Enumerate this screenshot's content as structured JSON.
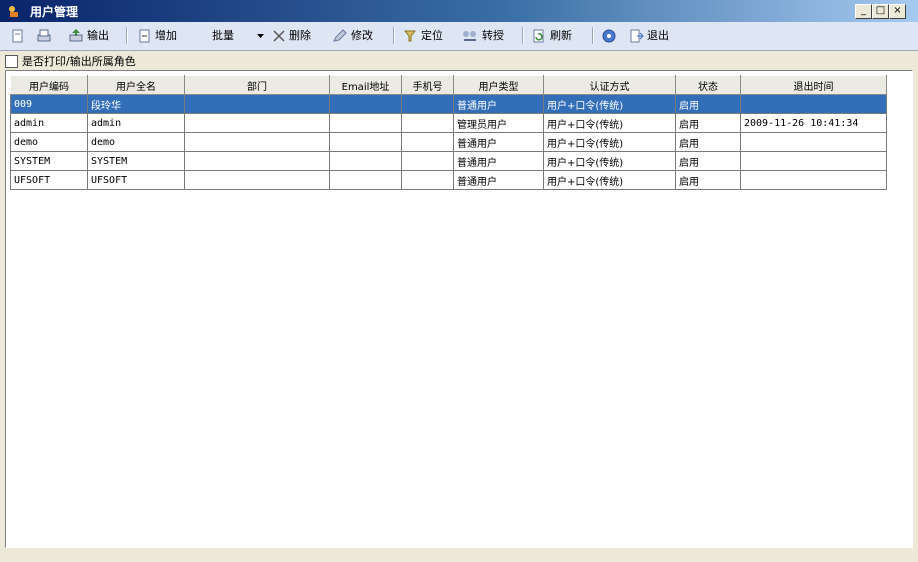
{
  "window": {
    "title": "用户管理",
    "minimize": "_",
    "restore": "□",
    "close": "×"
  },
  "toolbar": {
    "export_label": "输出",
    "add_label": "增加",
    "batch_label": "批量",
    "delete_label": "删除",
    "modify_label": "修改",
    "locate_label": "定位",
    "transfer_label": "转授",
    "refresh_label": "刷新",
    "exit_label": "退出"
  },
  "options": {
    "print_roles_label": "是否打印/输出所属角色",
    "print_roles_checked": false
  },
  "table": {
    "headers": [
      "用户编码",
      "用户全名",
      "部门",
      "Email地址",
      "手机号",
      "用户类型",
      "认证方式",
      "状态",
      "退出时间"
    ],
    "rows": [
      [
        "009",
        "段玲华",
        "",
        "",
        "",
        "普通用户",
        "用户+口令(传统)",
        "启用",
        ""
      ],
      [
        "admin",
        "admin",
        "",
        "",
        "",
        "管理员用户",
        "用户+口令(传统)",
        "启用",
        "2009-11-26 10:41:34"
      ],
      [
        "demo",
        "demo",
        "",
        "",
        "",
        "普通用户",
        "用户+口令(传统)",
        "启用",
        ""
      ],
      [
        "SYSTEM",
        "SYSTEM",
        "",
        "",
        "",
        "普通用户",
        "用户+口令(传统)",
        "启用",
        ""
      ],
      [
        "UFSOFT",
        "UFSOFT",
        "",
        "",
        "",
        "普通用户",
        "用户+口令(传统)",
        "启用",
        ""
      ]
    ],
    "selected_row": 0
  }
}
